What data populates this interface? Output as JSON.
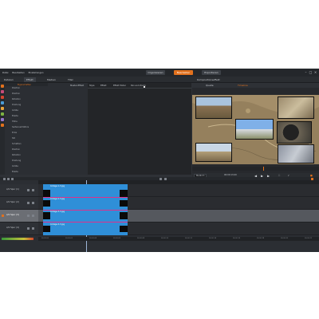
{
  "app": {
    "menu": [
      "Datei",
      "Bearbeiten",
      "Einstellungen"
    ],
    "tabs": [
      {
        "label": "Organisieren",
        "active": false
      },
      {
        "label": "Bearbeiten",
        "active": true
      },
      {
        "label": "Exportieren",
        "active": false
      }
    ],
    "accent": "#e2711d"
  },
  "subbar": {
    "left_tabs": [
      "Dateien",
      "Effekt",
      "Medien",
      "Titel"
    ],
    "preview_tabs": [
      "Quelle",
      "Timeline"
    ],
    "player_label": "Kompositionseffekt"
  },
  "props": {
    "header": [
      "Eigenschaften",
      "Master-Effekt",
      "Style",
      "Effekt",
      "Effekt Wider",
      "Pan and Zoom"
    ],
    "rows": [
      {
        "label": "Position"
      },
      {
        "label": "Position"
      },
      {
        "label": "Rotation"
      },
      {
        "label": "Drehung"
      },
      {
        "label": "Größe"
      },
      {
        "label": "Breite"
      },
      {
        "label": "Höhe"
      },
      {
        "label": "Seitenverhältnis"
      },
      {
        "label": "Ecke"
      },
      {
        "label": "Stil"
      },
      {
        "label": "Schatten"
      },
      {
        "label": "Position"
      },
      {
        "label": "Rotation"
      },
      {
        "label": "Drehung"
      },
      {
        "label": "Größe"
      },
      {
        "label": "Breite"
      },
      {
        "label": "Höhe"
      },
      {
        "label": "Weichzeichnen"
      }
    ]
  },
  "preview": {
    "quality": "Medium",
    "time": "00:00:13.00"
  },
  "timeline": {
    "tracks": [
      {
        "name": "A/V Spur (1)"
      },
      {
        "name": "A/V Spur (2)"
      },
      {
        "name": "A/V Spur (3)"
      },
      {
        "name": "A/V Spur (4)"
      }
    ],
    "clips": [
      "Collage 1-3.jpg",
      "Collage 2-3.jpg",
      "Collage 3-3.jpg",
      "Collage 4-3.jpg"
    ],
    "ruler": [
      "00:00:00",
      "00:00:02",
      "00:00:04",
      "00:00:06",
      "00:00:08",
      "00:00:10",
      "00:00:12",
      "00:00:14",
      "00:00:16",
      "00:00:18",
      "00:00:20",
      "00:00:22"
    ]
  }
}
